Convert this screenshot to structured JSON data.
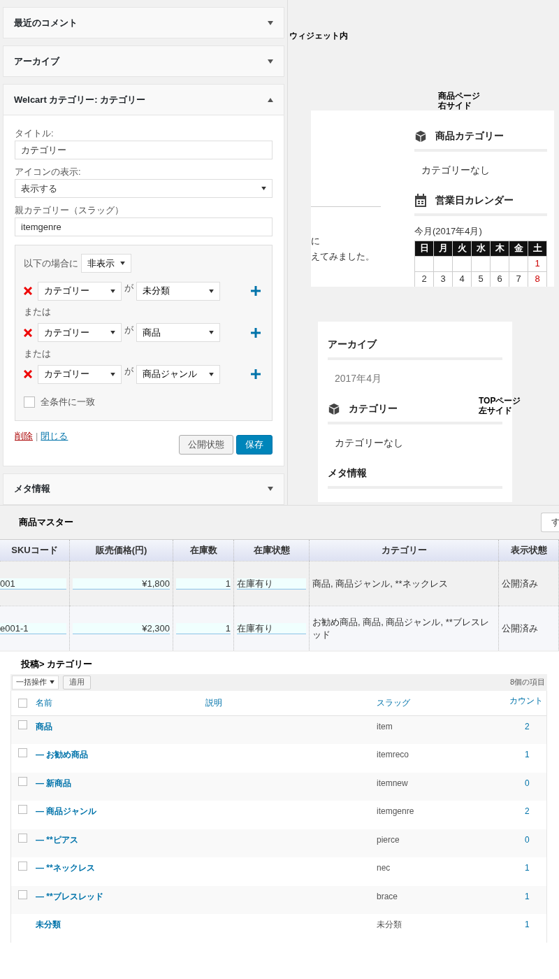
{
  "widget_area": {
    "label": "ウィジェット内",
    "widgets": [
      {
        "title": "最近のコメント",
        "expanded": false
      },
      {
        "title": "アーカイブ",
        "expanded": false
      },
      {
        "title": "Welcart カテゴリー: カテゴリー",
        "expanded": true,
        "form": {
          "fields": [
            {
              "kind": "text",
              "label": "タイトル:",
              "value": "カテゴリー"
            },
            {
              "kind": "select",
              "label": "アイコンの表示:",
              "value": "表示する"
            },
            {
              "kind": "text",
              "label": "親カテゴリー（スラッグ）",
              "value": "itemgenre"
            }
          ],
          "conditions": {
            "prefix": "以下の場合に",
            "action": "非表示",
            "rules": [
              {
                "field": "カテゴリー",
                "operator": "が",
                "value": "未分類",
                "joiner": "または"
              },
              {
                "field": "カテゴリー",
                "operator": "が",
                "value": "商品",
                "joiner": "または"
              },
              {
                "field": "カテゴリー",
                "operator": "が",
                "value": "商品ジャンル"
              }
            ],
            "match_all": {
              "label": "全条件に一致",
              "checked": false
            }
          },
          "links": [
            {
              "label": "削除",
              "kind": "danger"
            },
            {
              "label": "閉じる",
              "kind": "normal"
            }
          ],
          "link_separator": "|",
          "buttons": [
            {
              "label": "公開状態",
              "kind": "secondary"
            },
            {
              "label": "保存",
              "kind": "primary"
            }
          ]
        }
      },
      {
        "title": "メタ情報",
        "expanded": false
      }
    ]
  },
  "product_page": {
    "label_lines": [
      "商品ページ",
      "右サイド"
    ],
    "content_fragments": [
      "に",
      "えてみました。"
    ],
    "sidebar": [
      {
        "kind": "category",
        "title": "商品カテゴリー",
        "items": [
          "カテゴリーなし"
        ]
      },
      {
        "kind": "calendar",
        "title": "営業日カレンダー",
        "caption": "今月(2017年4月)",
        "weekdays": [
          "日",
          "月",
          "火",
          "水",
          "木",
          "金",
          "土"
        ],
        "first_week": [
          "1"
        ],
        "second_week": [
          "2",
          "3",
          "4",
          "5",
          "6",
          "7",
          "8"
        ]
      }
    ]
  },
  "top_page": {
    "label_lines": [
      "TOPページ",
      "左サイド"
    ],
    "widgets": [
      {
        "kind": "archive",
        "title": "アーカイブ",
        "items": [
          "2017年4月"
        ]
      },
      {
        "kind": "category",
        "title": "カテゴリー",
        "items": [
          "カテゴリーなし"
        ]
      },
      {
        "kind": "meta",
        "title": "メタ情報"
      }
    ]
  },
  "product_master": {
    "title": "商品マスター",
    "button": "す",
    "columns": [
      "SKUコード",
      "販売価格(円)",
      "在庫数",
      "在庫状態",
      "カテゴリー",
      "表示状態"
    ],
    "rows": [
      {
        "sku": "001",
        "price": "¥1,800",
        "stock": "1",
        "stock_status": "在庫有り",
        "categories": "商品, 商品ジャンル, **ネックレス",
        "display": "公開済み"
      },
      {
        "sku": "e001-1",
        "price": "¥2,300",
        "stock": "1",
        "stock_status": "在庫有り",
        "categories": "お勧め商品, 商品, 商品ジャンル, **ブレスレッド",
        "display": "公開済み"
      }
    ]
  },
  "category_list": {
    "title": "投稿> カテゴリー",
    "bulk_action": "一括操作",
    "apply": "適用",
    "item_count": "8個の項目",
    "select_all_checked": false,
    "columns": [
      "名前",
      "説明",
      "スラッグ",
      "カウント"
    ],
    "rows": [
      {
        "kind": "term",
        "checked": false,
        "name": "商品",
        "slug": "item",
        "count": "2"
      },
      {
        "kind": "term",
        "checked": false,
        "name": "— お勧め商品",
        "slug": "itemreco",
        "count": "1"
      },
      {
        "kind": "term",
        "checked": false,
        "name": "— 新商品",
        "slug": "itemnew",
        "count": "0"
      },
      {
        "kind": "term",
        "checked": false,
        "name": "— 商品ジャンル",
        "slug": "itemgenre",
        "count": "2"
      },
      {
        "kind": "term",
        "checked": false,
        "name": "— **ピアス",
        "slug": "pierce",
        "count": "0"
      },
      {
        "kind": "term",
        "checked": false,
        "name": "— **ネックレス",
        "slug": "nec",
        "count": "1"
      },
      {
        "kind": "term",
        "checked": false,
        "name": "— **ブレスレッド",
        "slug": "brace",
        "count": "1"
      },
      {
        "kind": "default",
        "name": "未分類",
        "slug": "未分類",
        "count": "1"
      }
    ]
  }
}
